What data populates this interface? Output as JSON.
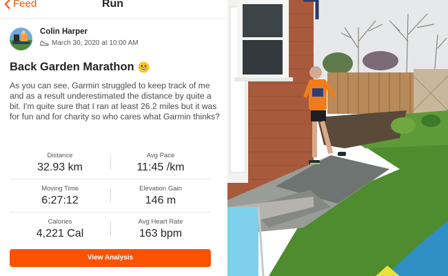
{
  "header": {
    "back_label": "Feed",
    "title": "Run"
  },
  "activity": {
    "athlete_name": "Colin Harper",
    "timestamp": "March 30, 2020 at 10:00 AM",
    "title": "Back Garden Marathon",
    "description": "As you can see, Garmin struggled to keep track of me and as a result underestimated the distance by quite a bit. I'm quite sure that I ran at least 26.2 miles but it was for fun and for charity so who cares what Garmin thinks?"
  },
  "stats": [
    {
      "left": {
        "label": "Distance",
        "value": "32.93 km"
      },
      "right": {
        "label": "Avg Pace",
        "value": "11:45 /km"
      }
    },
    {
      "left": {
        "label": "Moving Time",
        "value": "6:27:12"
      },
      "right": {
        "label": "Elevation Gain",
        "value": "146 m"
      }
    },
    {
      "left": {
        "label": "Calories",
        "value": "4,221 Cal"
      },
      "right": {
        "label": "Avg Heart Rate",
        "value": "163 bpm"
      }
    }
  ],
  "action": {
    "view_analysis_label": "View Analysis"
  },
  "colors": {
    "accent": "#fc5200",
    "text": "#242428",
    "secondary_text": "#55555c"
  },
  "icons": {
    "back": "chevron-left-icon",
    "activity_type": "shoe-icon",
    "emoji": "smiley-emoji-icon"
  }
}
